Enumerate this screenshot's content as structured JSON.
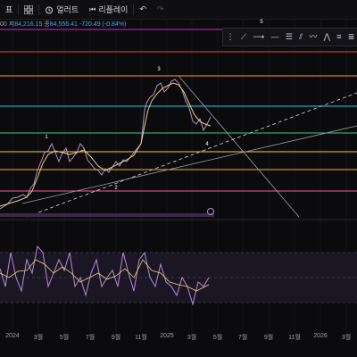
{
  "toolbar": {
    "left_label": "표",
    "alert_label": "얼러트",
    "replay_label": "리플레이",
    "undo_icon": "undo-icon",
    "redo_icon": "redo-icon"
  },
  "ohlc": {
    "prefix": "00",
    "lo_label": "저",
    "lo_value": "84,216.15",
    "close_label": "종",
    "close_value": "84,556.41",
    "change": "-720.49 (-0.84%)"
  },
  "annotations": {
    "wave_1": "1",
    "wave_2": "2",
    "wave_3": "3",
    "wave_4": "4",
    "wave_5": "5"
  },
  "time_axis": [
    "2024",
    "3월",
    "5월",
    "7월",
    "9월",
    "11월",
    "2025",
    "3월",
    "5월",
    "7월",
    "9월",
    "11월",
    "2026",
    "3월"
  ],
  "colors": {
    "background": "#0b0b0d",
    "magenta_line": "#d81ee0",
    "red_line": "#ff3b3b",
    "cyan_line": "#30c7e6",
    "green_line": "#33d17a",
    "orange_line": "#ffb020",
    "pink_line": "#ff5c8a",
    "candle": "#b98bd6",
    "ma": "#e8d27a"
  }
}
